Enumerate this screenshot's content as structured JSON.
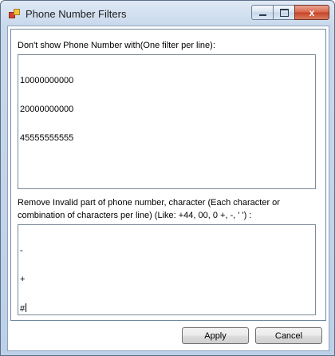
{
  "window": {
    "title": "Phone Number Filters",
    "controls": {
      "minimize": "",
      "maximize": "",
      "close": "x"
    }
  },
  "filters": {
    "label": "Don't show Phone Number with(One filter per line):",
    "lines": [
      "10000000000",
      "20000000000",
      "45555555555"
    ]
  },
  "invalid_chars": {
    "label": "Remove Invalid part of phone number, character (Each character or combination of characters per line) (Like: +44, 00, 0 +, -, ' ') :",
    "lines": [
      "-",
      "+",
      "#"
    ]
  },
  "buttons": {
    "apply": "Apply",
    "cancel": "Cancel"
  }
}
